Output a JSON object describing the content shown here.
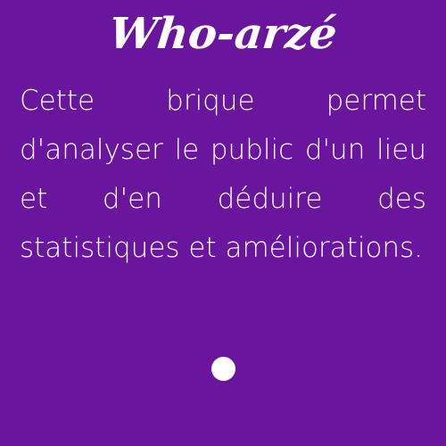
{
  "card": {
    "title": "Who-arzé",
    "description": "Cette brique permet d'analyser le public d'un lieu et d'en déduire des statistiques et améliorations.",
    "indicator": "dot-icon"
  },
  "colors": {
    "background": "#6a159e",
    "text": "#ffffff",
    "dot": "#ffffff"
  }
}
